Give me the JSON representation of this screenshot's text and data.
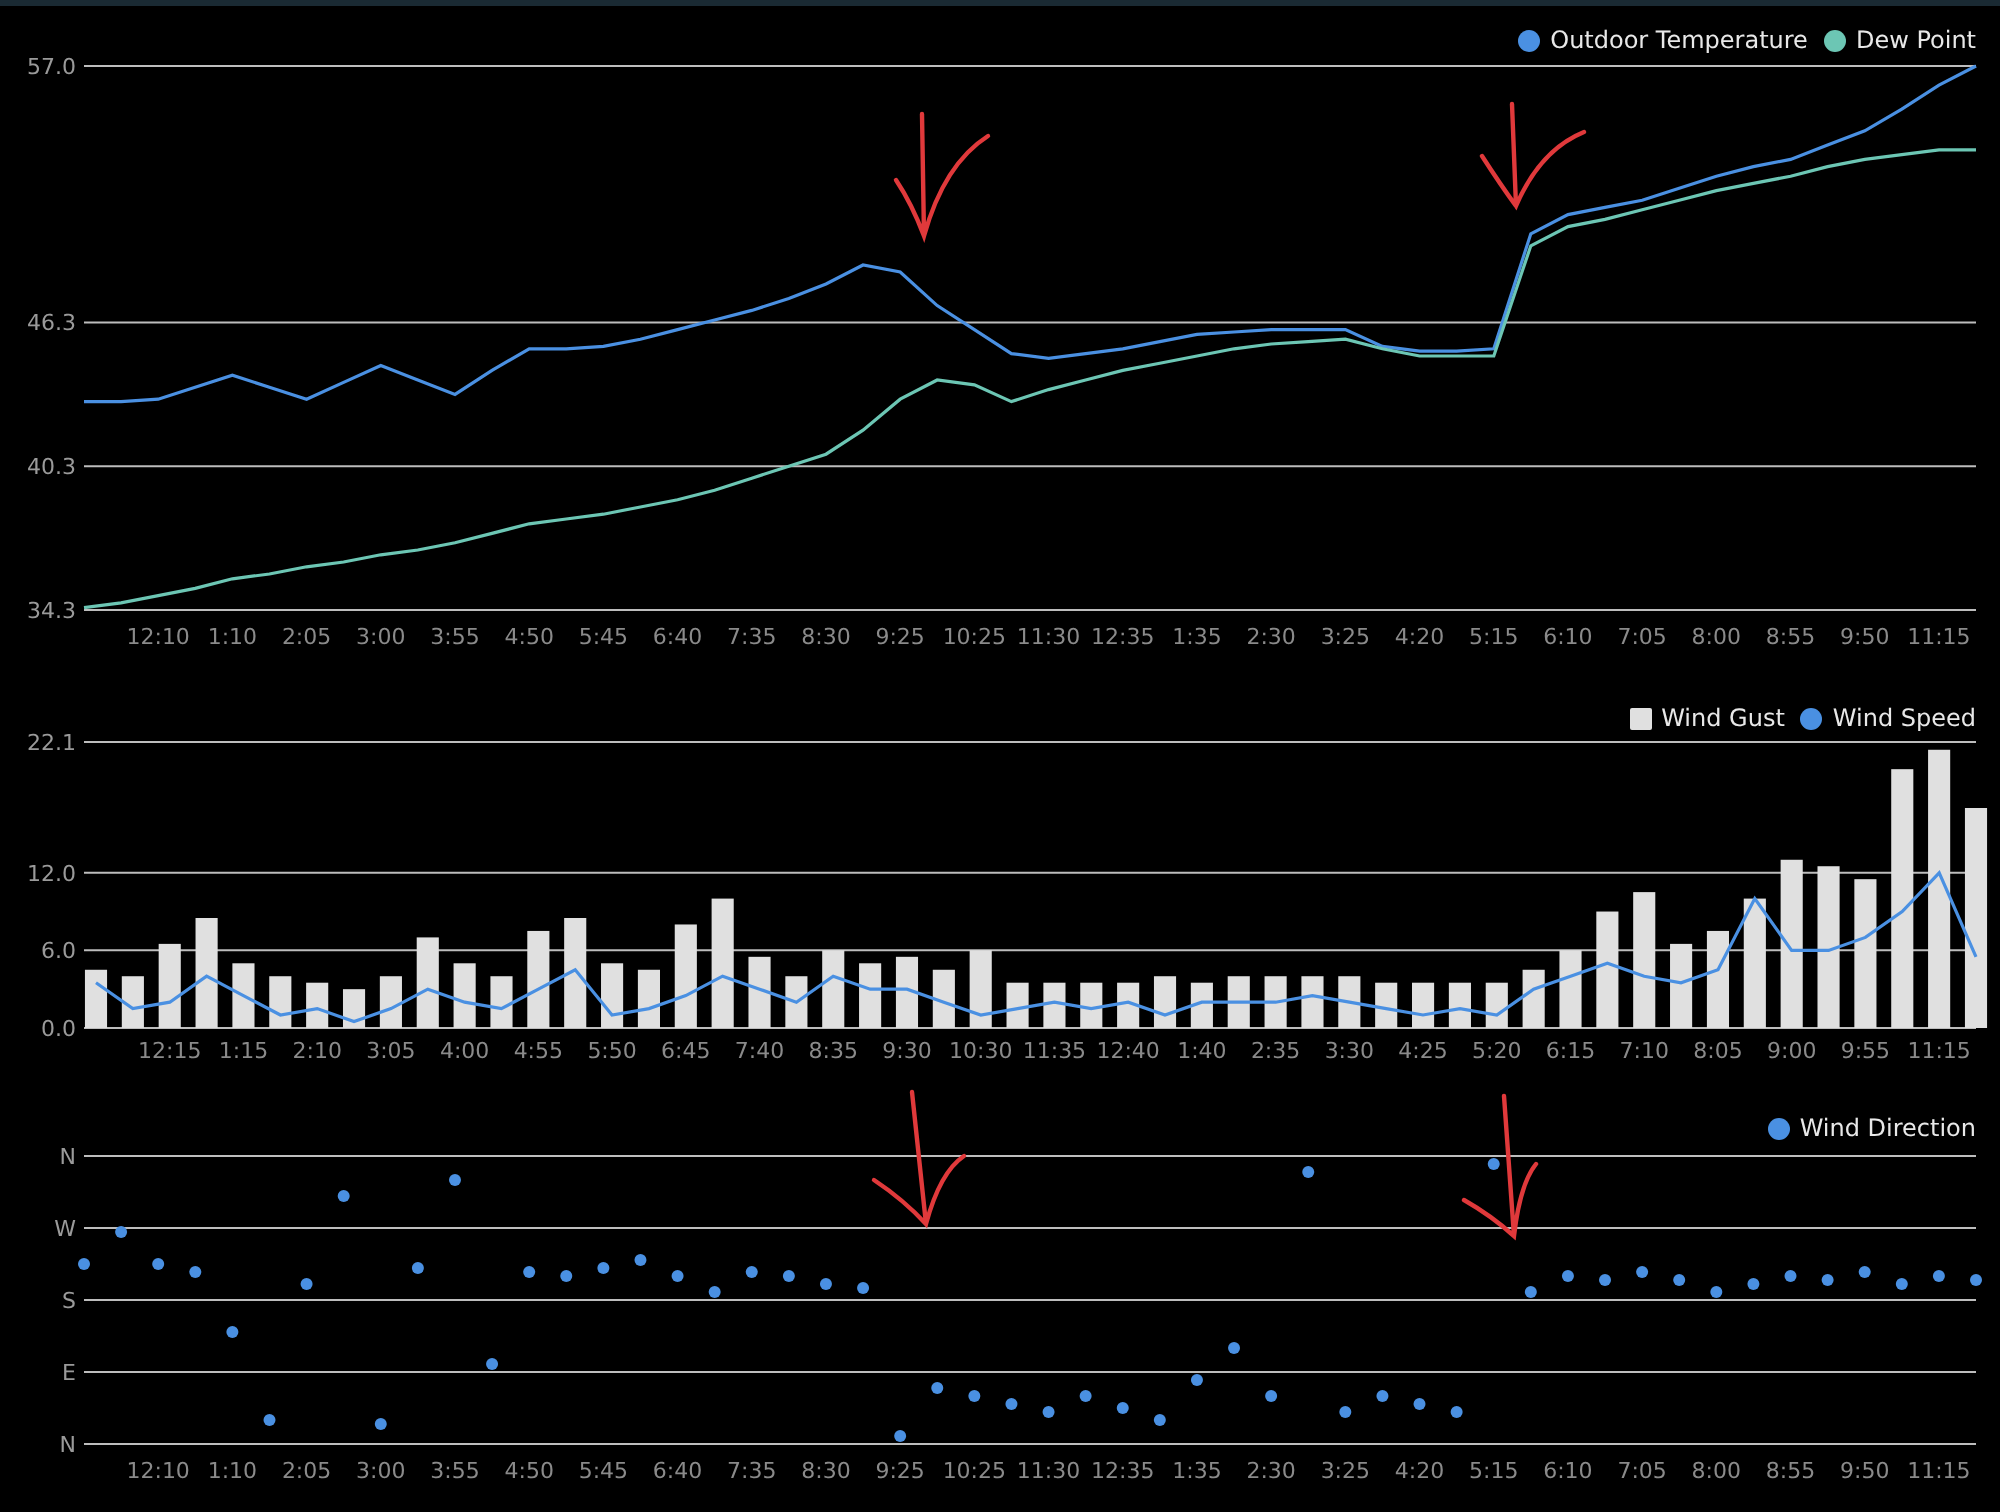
{
  "temperature_chart": {
    "chart_data": {
      "type": "line",
      "ylim": [
        34.3,
        57.0
      ],
      "yticks": [
        34.3,
        40.3,
        46.3,
        {
          "value": 57.0,
          "label": "57.0"
        }
      ],
      "categories": [
        null,
        null,
        "12:10",
        null,
        "1:10",
        null,
        "2:05",
        null,
        "3:00",
        null,
        "3:55",
        null,
        "4:50",
        null,
        "5:45",
        null,
        "6:40",
        null,
        "7:35",
        null,
        "8:30",
        null,
        "9:25",
        null,
        "10:25",
        null,
        "11:30",
        null,
        "12:35",
        null,
        "1:35",
        null,
        "2:30",
        null,
        "3:25",
        null,
        "4:20",
        null,
        "5:15",
        null,
        "6:10",
        null,
        "7:05",
        null,
        "8:00",
        null,
        "8:55",
        null,
        "9:50",
        null,
        "11:15",
        null
      ],
      "series": [
        {
          "name": "Outdoor Temperature",
          "color": "#4a90e2",
          "values": [
            43.0,
            43.0,
            43.1,
            43.6,
            44.1,
            43.6,
            43.1,
            43.8,
            44.5,
            43.9,
            43.3,
            44.3,
            45.2,
            45.2,
            45.3,
            45.6,
            46.0,
            46.4,
            46.8,
            47.3,
            47.9,
            48.7,
            48.4,
            47.0,
            46.0,
            45.0,
            44.8,
            45.0,
            45.2,
            45.5,
            45.8,
            45.9,
            46.0,
            46.0,
            46.0,
            45.3,
            45.1,
            45.1,
            45.2,
            50.0,
            50.8,
            51.1,
            51.4,
            51.9,
            52.4,
            52.8,
            53.1,
            53.7,
            54.3,
            55.2,
            56.2,
            57.0
          ]
        },
        {
          "name": "Dew Point",
          "color": "#6cc6b4",
          "values": [
            34.4,
            34.6,
            34.9,
            35.2,
            35.6,
            35.8,
            36.1,
            36.3,
            36.6,
            36.8,
            37.1,
            37.5,
            37.9,
            38.1,
            38.3,
            38.6,
            38.9,
            39.3,
            39.8,
            40.3,
            40.8,
            41.8,
            43.1,
            43.9,
            43.7,
            43.0,
            43.5,
            43.9,
            44.3,
            44.6,
            44.9,
            45.2,
            45.4,
            45.5,
            45.6,
            45.2,
            44.9,
            44.9,
            44.9,
            49.5,
            50.3,
            50.6,
            51.0,
            51.4,
            51.8,
            52.1,
            52.4,
            52.8,
            53.1,
            53.3,
            53.5,
            53.5
          ]
        }
      ]
    }
  },
  "wind_chart": {
    "chart_data": {
      "type": "bar",
      "ylim": [
        0,
        22.1
      ],
      "yticks": [
        {
          "value": 0,
          "label": "0.0"
        },
        {
          "value": 6,
          "label": "6.0"
        },
        {
          "value": 12,
          "label": "12.0"
        },
        22.1
      ],
      "categories": [
        null,
        null,
        "12:15",
        null,
        "1:15",
        null,
        "2:10",
        null,
        "3:05",
        null,
        "4:00",
        null,
        "4:55",
        null,
        "5:50",
        null,
        "6:45",
        null,
        "7:40",
        null,
        "8:35",
        null,
        "9:30",
        null,
        "10:30",
        null,
        "11:35",
        null,
        "12:40",
        null,
        "1:40",
        null,
        "2:35",
        null,
        "3:30",
        null,
        "4:25",
        null,
        "5:20",
        null,
        "6:15",
        null,
        "7:10",
        null,
        "8:05",
        null,
        "9:00",
        null,
        "9:55",
        null,
        "11:15",
        null
      ],
      "series": [
        {
          "name": "Wind Gust",
          "color": "#e0e0e0",
          "values": [
            4.5,
            4,
            6.5,
            8.5,
            5,
            4,
            3.5,
            3,
            4,
            7,
            5,
            4,
            7.5,
            8.5,
            5,
            4.5,
            8,
            10,
            5.5,
            4,
            6,
            5,
            5.5,
            4.5,
            6,
            3.5,
            3.5,
            3.5,
            3.5,
            4,
            3.5,
            4,
            4,
            4,
            4,
            3.5,
            3.5,
            3.5,
            3.5,
            4.5,
            6,
            9,
            10.5,
            6.5,
            7.5,
            10,
            13,
            12.5,
            11.5,
            20,
            21.5,
            17
          ]
        },
        {
          "name": "Wind Speed",
          "type": "line",
          "color": "#4a90e2",
          "values": [
            3.5,
            1.5,
            2,
            4,
            2.5,
            1,
            1.5,
            0.5,
            1.5,
            3,
            2,
            1.5,
            3,
            4.5,
            1,
            1.5,
            2.5,
            4,
            3,
            2,
            4,
            3,
            3,
            2,
            1,
            1.5,
            2,
            1.5,
            2,
            1,
            2,
            2,
            2,
            2.5,
            2,
            1.5,
            1,
            1.5,
            1,
            3,
            4,
            5,
            4,
            3.5,
            4.5,
            10,
            6,
            6,
            7,
            9,
            12,
            5.5
          ]
        }
      ]
    }
  },
  "direction_chart": {
    "legend": [
      {
        "label": "Wind Direction",
        "color": "#4a90e2"
      }
    ],
    "y_axis_labels": [
      "N",
      "W",
      "S",
      "E",
      "N"
    ],
    "x_axis_labels": [
      "12:10",
      "1:10",
      "2:05",
      "3:00",
      "3:55",
      "4:50",
      "5:45",
      "6:40",
      "7:35",
      "8:30",
      "9:25",
      "10:25",
      "11:30",
      "12:35",
      "1:35",
      "2:30",
      "3:25",
      "4:20",
      "5:15",
      "6:10",
      "7:05",
      "8:00",
      "8:55",
      "9:50",
      "11:15"
    ]
  }
}
